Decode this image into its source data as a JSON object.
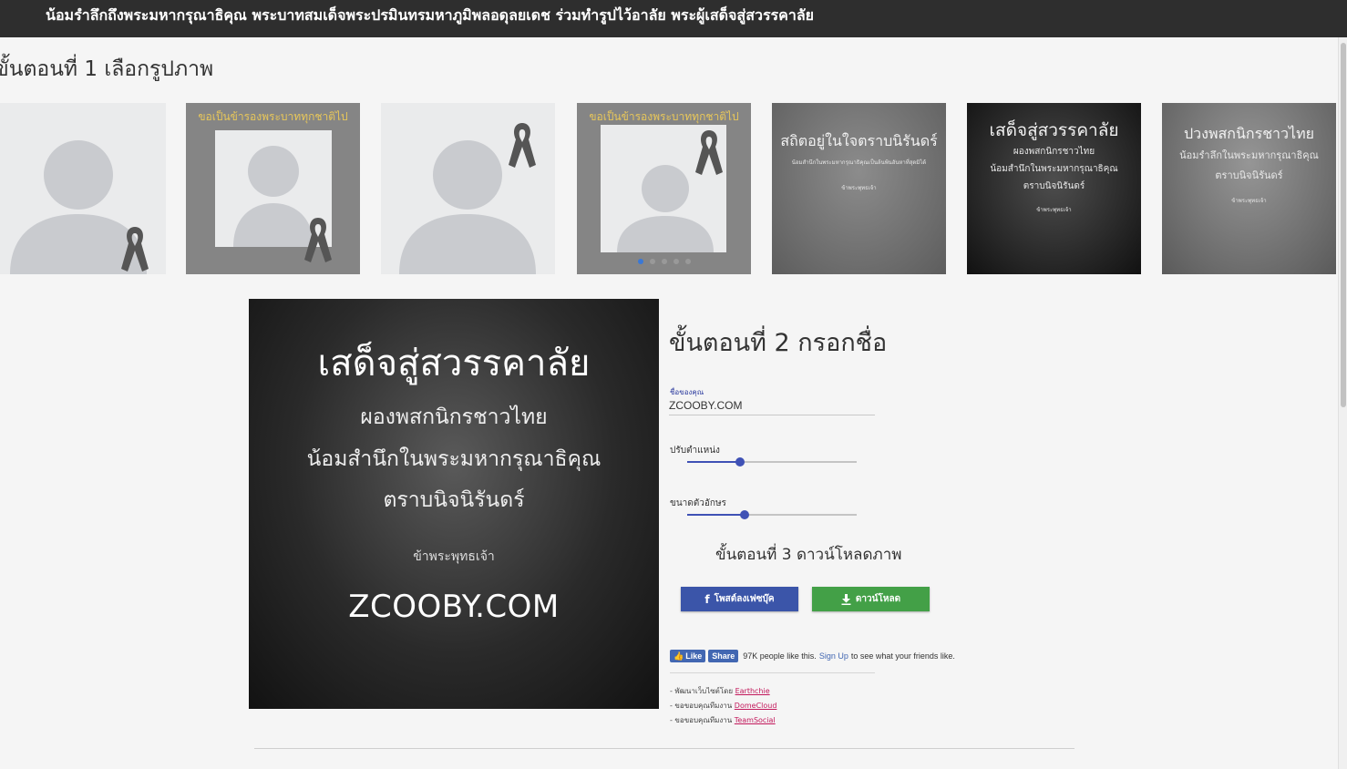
{
  "header": {
    "title": "น้อมรำลึกถึงพระมหากรุณาธิคุณ พระบาทสมเด็จพระปรมินทรมหาภูมิพลอดุลยเดช ร่วมทำรูปไว้อาลัย พระผู้เสด็จสู่สวรรคาลัย"
  },
  "step1": {
    "title": "ขั้นตอนที่ 1 เลือกรูปภาพ"
  },
  "templates": {
    "frame_caption": "ขอเป็นข้ารองพระบาททุกชาติไป",
    "card5": {
      "title": "สถิตอยู่ในใจตราบนิรันดร์",
      "line1": "น้อมสำนึกในพระมหากรุณาธิคุณเป็นล้นพ้นอันหาที่สุดมิได้",
      "sign": "ข้าพระพุทธเจ้า"
    },
    "card6": {
      "title": "เสด็จสู่สวรรคาลัย",
      "line1": "ผองพสกนิกรชาวไทย",
      "line2": "น้อมสำนึกในพระมหากรุณาธิคุณ",
      "line3": "ตราบนิจนิรันดร์",
      "sign": "ข้าพระพุทธเจ้า"
    },
    "card7": {
      "title": "ปวงพสกนิกรชาวไทย",
      "line1": "น้อมรำลึกในพระมหากรุณาธิคุณ",
      "line2": "ตราบนิจนิรันดร์",
      "sign": "ข้าพระพุทธเจ้า"
    },
    "carousel_active_index": 0,
    "carousel_count": 5
  },
  "preview": {
    "title": "เสด็จสู่สวรรคาลัย",
    "line1": "ผองพสกนิกรชาวไทย",
    "line2": "น้อมสำนึกในพระมหากรุณาธิคุณ",
    "line3": "ตราบนิจนิรันดร์",
    "sign": "ข้าพระพุทธเจ้า",
    "name": "ZCOOBY.COM"
  },
  "step2": {
    "title": "ขั้นตอนที่ 2 กรอกชื่อ",
    "name_label": "ชื่อของคุณ",
    "name_value": "ZCOOBY.COM",
    "position_label": "ปรับตำแหน่ง",
    "position_value": 0.31,
    "font_size_label": "ขนาดตัวอักษร",
    "font_size_value": 0.34
  },
  "step3": {
    "title": "ขั้นตอนที่ 3 ดาวน์โหลดภาพ",
    "facebook_label": "โพสต์ลงเฟซบุ๊ค",
    "download_label": "ดาวน์โหลด"
  },
  "social": {
    "like_label": "Like",
    "share_label": "Share",
    "like_text": "97K people like this.",
    "signup_link": "Sign Up",
    "signup_suffix": "to see what your friends like."
  },
  "credits": [
    {
      "prefix": "- พัฒนาเว็บไซต์โดย",
      "link": "Earthchie"
    },
    {
      "prefix": "- ขอขอบคุณทีมงาน",
      "link": "DomeCloud"
    },
    {
      "prefix": "- ขอขอบคุณทีมงาน",
      "link": "TeamSocial"
    }
  ],
  "colors": {
    "header_bg": "#2e2e2e",
    "accent_blue": "#3f51b5",
    "facebook_blue": "#3b55a9",
    "download_green": "#43a047",
    "frame_gold": "#e8c75a"
  },
  "icons": {
    "avatar": "user-silhouette-icon",
    "ribbon": "mourning-ribbon-icon",
    "facebook": "facebook-f-icon",
    "download": "download-arrow-icon",
    "like": "thumbs-up-icon"
  }
}
